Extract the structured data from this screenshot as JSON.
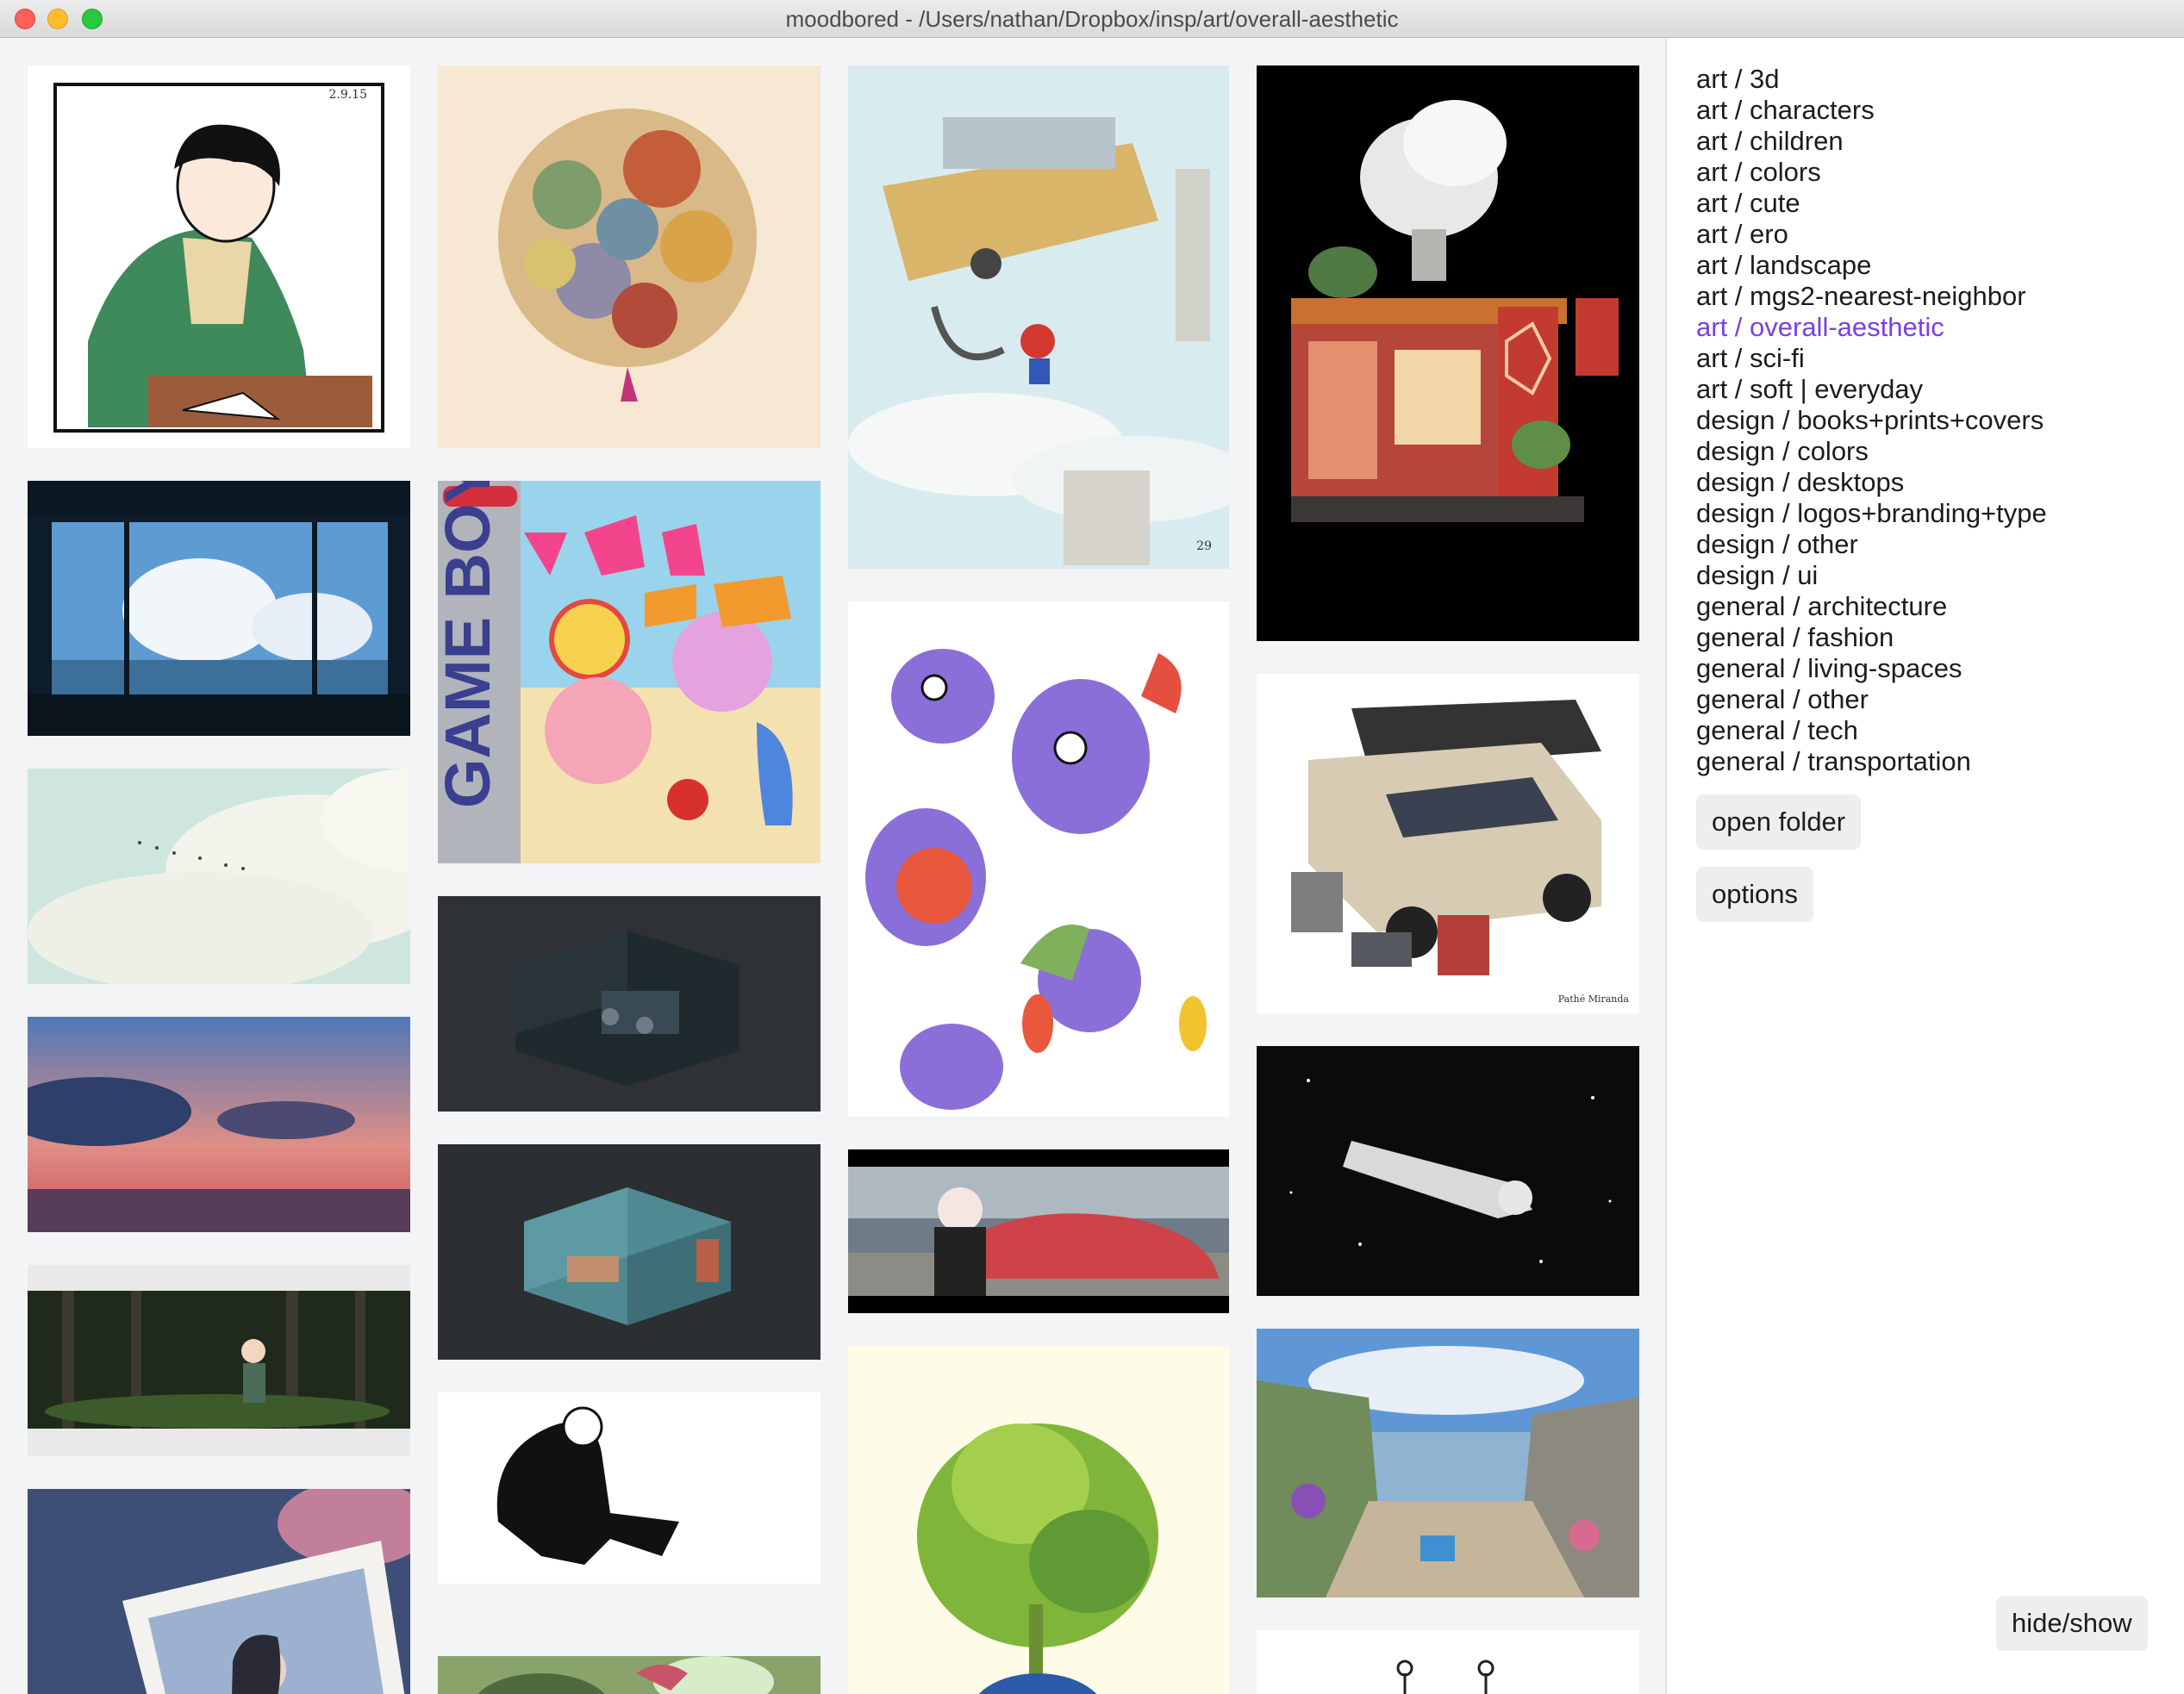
{
  "window": {
    "title": "moodbored - /Users/nathan/Dropbox/insp/art/overall-aesthetic"
  },
  "gallery": {
    "tiles": [
      {
        "name": "tile-manga-boy",
        "caption": "2.9.15"
      },
      {
        "name": "tile-balloon-pile",
        "caption": ""
      },
      {
        "name": "tile-mario-airship",
        "caption": "29"
      },
      {
        "name": "tile-tiny-house",
        "caption": ""
      },
      {
        "name": "tile-window-sky",
        "caption": ""
      },
      {
        "name": "tile-gameboy-box",
        "caption": ""
      },
      {
        "name": "tile-clouds-birds",
        "caption": ""
      },
      {
        "name": "tile-pikmin-sketch",
        "caption": ""
      },
      {
        "name": "tile-van-gear",
        "caption": "Pathé Miranda"
      },
      {
        "name": "tile-dark-room-1",
        "caption": ""
      },
      {
        "name": "tile-sunset-clouds",
        "caption": ""
      },
      {
        "name": "tile-dark-room-2",
        "caption": ""
      },
      {
        "name": "tile-space-figure",
        "caption": ""
      },
      {
        "name": "tile-car-girl",
        "caption": ""
      },
      {
        "name": "tile-forest-girl",
        "caption": ""
      },
      {
        "name": "tile-silhouette",
        "caption": ""
      },
      {
        "name": "tile-alley-flowers",
        "caption": ""
      },
      {
        "name": "tile-plant-pot",
        "caption": ""
      },
      {
        "name": "tile-polaroid-girl",
        "caption": ""
      },
      {
        "name": "tile-green-garden",
        "caption": ""
      },
      {
        "name": "tile-lamps",
        "caption": ""
      }
    ]
  },
  "sidebar": {
    "categories": [
      "art / 3d",
      "art / characters",
      "art / children",
      "art / colors",
      "art / cute",
      "art / ero",
      "art / landscape",
      "art / mgs2-nearest-neighbor",
      "art / overall-aesthetic",
      "art / sci-fi",
      "art / soft | everyday",
      "design / books+prints+covers",
      "design / colors",
      "design / desktops",
      "design / logos+branding+type",
      "design / other",
      "design / ui",
      "general / architecture",
      "general / fashion",
      "general / living-spaces",
      "general / other",
      "general / tech",
      "general / transportation"
    ],
    "active": "art / overall-aesthetic",
    "open_folder_label": "open folder",
    "options_label": "options",
    "hide_show_label": "hide/show"
  },
  "colors": {
    "active_category": "#7a3fe4",
    "sidebar_bg": "#ffffff",
    "gallery_bg": "#f3f4f6"
  }
}
